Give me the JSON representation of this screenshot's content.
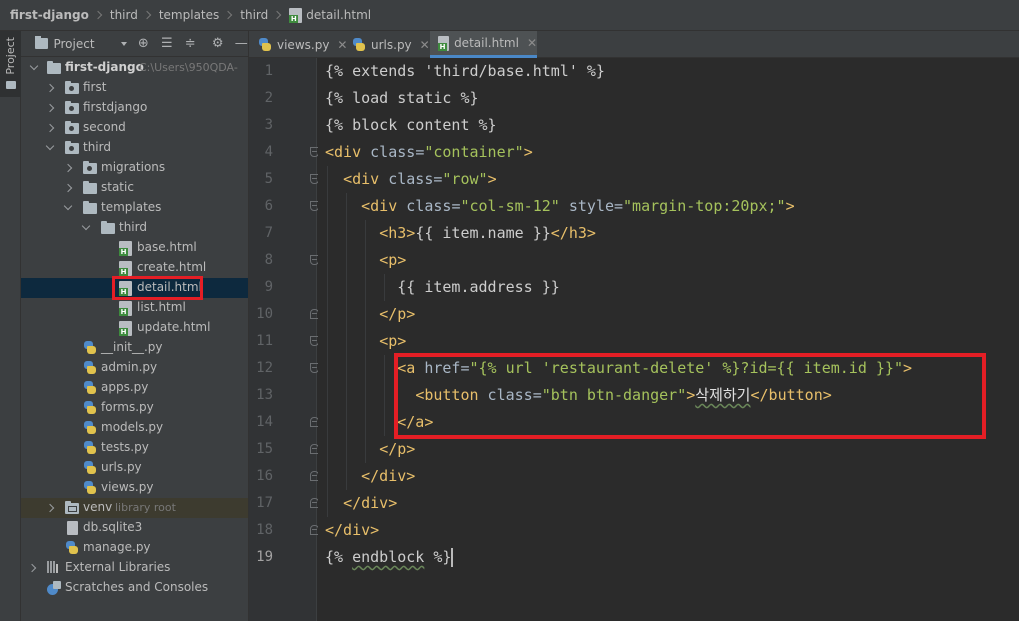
{
  "breadcrumb": {
    "project": "first-django",
    "items": [
      "third",
      "templates",
      "third"
    ],
    "file": "detail.html"
  },
  "left_stripe": {
    "label": "Project"
  },
  "panel": {
    "title": "Project",
    "tree": [
      {
        "key": "first_django",
        "label": "first-django",
        "hint": "C:\\Users\\950QDA-",
        "icon": "root-folder-icon"
      },
      {
        "key": "first",
        "label": "first",
        "icon": "package-folder-icon"
      },
      {
        "key": "firstdjango",
        "label": "firstdjango",
        "icon": "package-folder-icon"
      },
      {
        "key": "second",
        "label": "second",
        "icon": "package-folder-icon"
      },
      {
        "key": "third",
        "label": "third",
        "icon": "package-folder-icon"
      },
      {
        "key": "migrations",
        "label": "migrations",
        "icon": "package-folder-icon"
      },
      {
        "key": "static",
        "label": "static",
        "icon": "folder-icon"
      },
      {
        "key": "templates",
        "label": "templates",
        "icon": "folder-icon"
      },
      {
        "key": "third_tpl",
        "label": "third",
        "icon": "folder-icon"
      },
      {
        "key": "base",
        "label": "base.html",
        "icon": "html-file-icon"
      },
      {
        "key": "create",
        "label": "create.html",
        "icon": "html-file-icon"
      },
      {
        "key": "detail",
        "label": "detail.html",
        "icon": "html-file-icon"
      },
      {
        "key": "list",
        "label": "list.html",
        "icon": "html-file-icon"
      },
      {
        "key": "update",
        "label": "update.html",
        "icon": "html-file-icon"
      },
      {
        "key": "init",
        "label": "__init__.py",
        "icon": "python-file-icon"
      },
      {
        "key": "admin",
        "label": "admin.py",
        "icon": "python-file-icon"
      },
      {
        "key": "apps",
        "label": "apps.py",
        "icon": "python-file-icon"
      },
      {
        "key": "forms",
        "label": "forms.py",
        "icon": "python-file-icon"
      },
      {
        "key": "models",
        "label": "models.py",
        "icon": "python-file-icon"
      },
      {
        "key": "tests",
        "label": "tests.py",
        "icon": "python-file-icon"
      },
      {
        "key": "urls",
        "label": "urls.py",
        "icon": "python-file-icon"
      },
      {
        "key": "views",
        "label": "views.py",
        "icon": "python-file-icon"
      },
      {
        "key": "venv",
        "label": "venv",
        "hint": "library root",
        "icon": "venv-folder-icon"
      },
      {
        "key": "db",
        "label": "db.sqlite3",
        "icon": "database-file-icon"
      },
      {
        "key": "manage",
        "label": "manage.py",
        "icon": "python-file-icon"
      },
      {
        "key": "ext_libs",
        "label": "External Libraries",
        "icon": "library-icon"
      },
      {
        "key": "scratches",
        "label": "Scratches and Consoles",
        "icon": "scratches-icon"
      }
    ]
  },
  "tabs": [
    {
      "label": "views.py",
      "icon": "python-file-icon"
    },
    {
      "label": "urls.py",
      "icon": "python-file-icon"
    },
    {
      "label": "detail.html",
      "icon": "html-file-icon",
      "active": true
    }
  ],
  "editor": {
    "current_line": 19,
    "line_numbers": [
      "1",
      "2",
      "3",
      "4",
      "5",
      "6",
      "7",
      "8",
      "9",
      "10",
      "11",
      "12",
      "13",
      "14",
      "15",
      "16",
      "17",
      "18",
      "19"
    ],
    "lines": [
      "{% extends 'third/base.html' %}",
      "{% load static %}",
      "{% block content %}",
      "<div class=\"container\">",
      "  <div class=\"row\">",
      "    <div class=\"col-sm-12\" style=\"margin-top:20px;\">",
      "      <h3>{{ item.name }}</h3>",
      "      <p>",
      "        {{ item.address }}",
      "      </p>",
      "      <p>",
      "        <a href=\"{% url 'restaurant-delete' %}?id={{ item.id }}\">",
      "          <button class=\"btn btn-danger\">삭제하기</button>",
      "        </a>",
      "      </p>",
      "    </div>",
      "  </div>",
      "</div>",
      "{% endblock %}"
    ]
  },
  "colors": {
    "highlight_box": "#e41e25",
    "html_tag": "#e8bf6a",
    "string": "#a5c25c",
    "selection": "#0d293e"
  }
}
